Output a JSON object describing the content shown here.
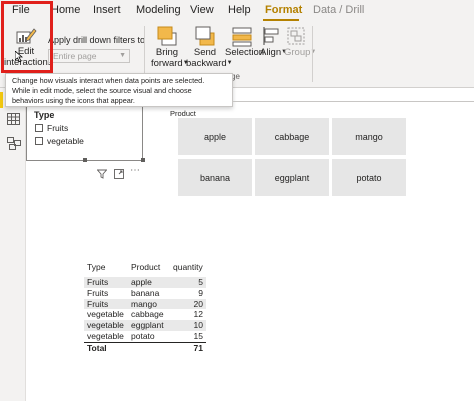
{
  "menu": {
    "tabs": [
      "File",
      "Home",
      "Insert",
      "Modeling",
      "View",
      "Help",
      "Format",
      "Data / Drill"
    ],
    "active": "Format"
  },
  "ribbon": {
    "edit_interactions": {
      "line1": "Edit",
      "line2": "interactions"
    },
    "apply_drill": {
      "label": "Apply drill down filters to",
      "placeholder": "Entire page"
    },
    "bring_forward": {
      "line1": "Bring",
      "line2": "forward"
    },
    "send_backward": {
      "line1": "Send",
      "line2": "backward"
    },
    "selection": "Selection",
    "align": "Align",
    "group": "Group",
    "group_label_fragment": "ge"
  },
  "tooltip": {
    "lines": [
      "Change how visuals interact when data points are selected.",
      "While in edit mode, select the source visual and choose",
      "behaviors using the icons that appear."
    ]
  },
  "slicer": {
    "title": "Type",
    "items": [
      "Fruits",
      "vegetable"
    ]
  },
  "product_visual": {
    "title": "Product",
    "tiles": [
      "apple",
      "cabbage",
      "mango",
      "banana",
      "eggplant",
      "potato"
    ]
  },
  "table": {
    "headers": [
      "Type",
      "Product",
      "quantity"
    ],
    "rows": [
      [
        "Fruits",
        "apple",
        "5"
      ],
      [
        "Fruits",
        "banana",
        "9"
      ],
      [
        "Fruits",
        "mango",
        "20"
      ],
      [
        "vegetable",
        "cabbage",
        "12"
      ],
      [
        "vegetable",
        "eggplant",
        "10"
      ],
      [
        "vegetable",
        "potato",
        "15"
      ]
    ],
    "total": [
      "Total",
      "",
      "71"
    ]
  },
  "colors": {
    "accent": "#b48100",
    "highlight": "#e0201b",
    "icon_orange": "#f2b84b",
    "tile_bg": "#e6e6e6",
    "row_stripe": "#e9e9e9"
  },
  "icons": [
    "edit-interactions-icon",
    "bring-forward-icon",
    "send-backward-icon",
    "selection-icon",
    "align-icon",
    "group-icon",
    "filter-icon",
    "focus-mode-icon",
    "more-options-icon",
    "table-view-icon",
    "model-view-icon",
    "mouse-cursor-icon"
  ]
}
